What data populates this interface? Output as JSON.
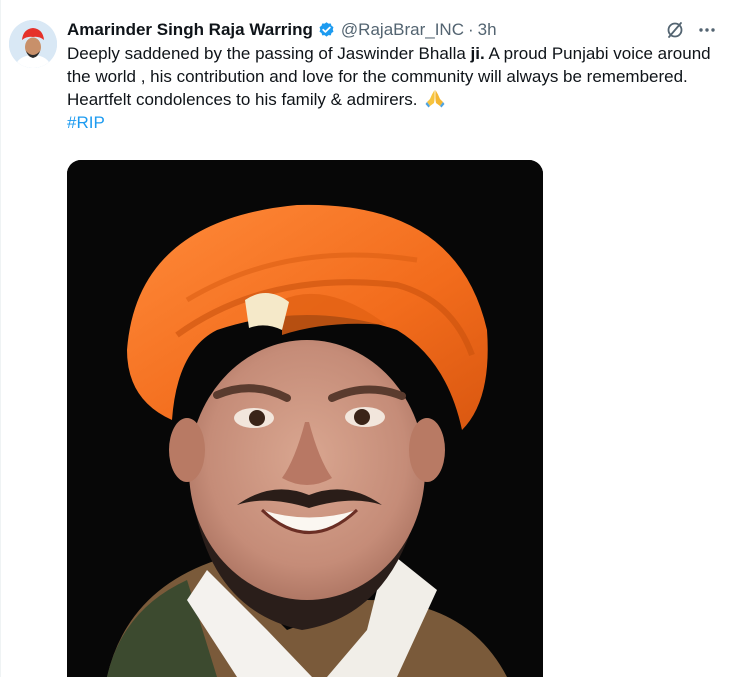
{
  "author": {
    "display_name": "Amarinder Singh Raja Warring",
    "handle": "@RajaBrar_INC",
    "separator": "·",
    "time": "3h",
    "verified_icon": "verified-badge-icon"
  },
  "tweet": {
    "text_part1": "Deeply saddened by the passing of Jaswinder Bhalla ",
    "text_bold": "ji.",
    "text_part2": " A proud Punjabi voice around the world , his contribution and love for the community will always be remembered. Heartfelt condolences to his family & admirers.",
    "emoji": "folded-hands-emoji",
    "hashtag": "#RIP"
  },
  "icons": {
    "grok": "grok-icon",
    "more": "more-icon"
  },
  "colors": {
    "link": "#1d9bf0",
    "secondary_text": "#536471",
    "turban": "#f26c1c",
    "photo_background": "#070707"
  }
}
